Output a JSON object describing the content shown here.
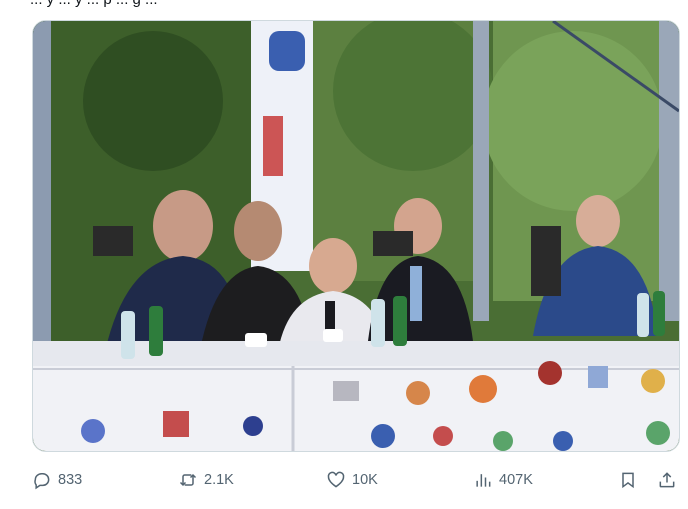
{
  "tweet": {
    "text_fragment": "... y ... y ... p ... g ...",
    "image_alt": "Leaders seated at a conference table"
  },
  "actions": {
    "reply": {
      "icon": "reply-icon",
      "count": "833"
    },
    "repost": {
      "icon": "repost-icon",
      "count": "2.1K"
    },
    "like": {
      "icon": "heart-icon",
      "count": "10K"
    },
    "views": {
      "icon": "views-icon",
      "count": "407K"
    },
    "bookmark": {
      "icon": "bookmark-icon"
    },
    "share": {
      "icon": "share-icon"
    }
  },
  "colors": {
    "icon_gray": "#536471",
    "border": "#cfd9de"
  }
}
